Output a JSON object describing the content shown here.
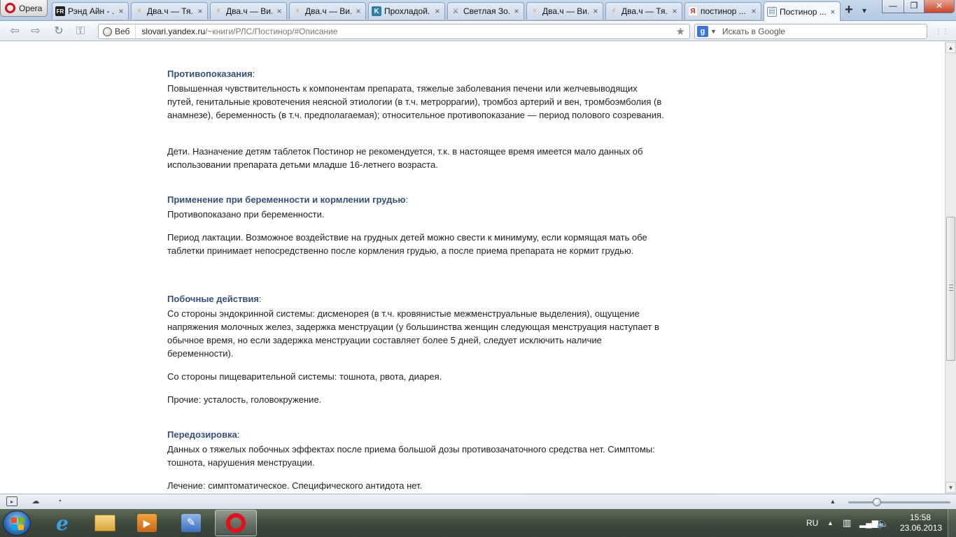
{
  "browser": {
    "menu_label": "Opera",
    "tabs": [
      {
        "title": "Рэнд Айн - ...",
        "icon": "fr-icon",
        "color": "#222222",
        "glyph": "FR"
      },
      {
        "title": "Два.ч — Тя...",
        "icon": "bolt-icon",
        "color": "#f08a24",
        "glyph": "⚡"
      },
      {
        "title": "Два.ч — Ви...",
        "icon": "bolt-icon",
        "color": "#f08a24",
        "glyph": "⚡"
      },
      {
        "title": "Два.ч — Ви...",
        "icon": "bolt-icon",
        "color": "#f08a24",
        "glyph": "⚡"
      },
      {
        "title": "Прохладой...",
        "icon": "k-icon",
        "color": "#2f7ea6",
        "glyph": "K"
      },
      {
        "title": "Светлая Зо...",
        "icon": "sword-icon",
        "color": "#555555",
        "glyph": "/"
      },
      {
        "title": "Два.ч — Ви...",
        "icon": "bolt-icon",
        "color": "#f08a24",
        "glyph": "⚡"
      },
      {
        "title": "Два.ч — Тя...",
        "icon": "bolt-icon",
        "color": "#f08a24",
        "glyph": "⚡"
      },
      {
        "title": "постинор ...",
        "icon": "yandex-icon",
        "color": "#e02020",
        "glyph": "Я"
      },
      {
        "title": "Постинор ...",
        "icon": "page-icon",
        "color": "#6a8bb5",
        "glyph": "▤"
      }
    ],
    "active_tab": 9,
    "address": {
      "badge": "Веб",
      "domain": "slovari.yandex.ru",
      "path": "/~книги/РЛС/Постинор/#Описание"
    },
    "search_placeholder": "Искать в Google"
  },
  "article": {
    "sections": [
      {
        "heading": "Противопоказания",
        "paragraphs": [
          "Повышенная чувствительность к компонентам препарата, тяжелые заболевания печени или желчевыводящих путей, генитальные кровотечения неясной этиологии (в т.ч. метроррагии), тромбоз артерий и вен, тромбоэмболия (в анамнезе), беременность (в т.ч. предполагаемая); относительное противопоказание — период полового созревания.",
          "Дети. Назначение детям таблеток Постинор не рекомендуется, т.к. в настоящее время имеется мало данных об использовании препарата детьми младше 16-летнего возраста."
        ]
      },
      {
        "heading": "Применение при беременности и кормлении грудью",
        "paragraphs": [
          "Противопоказано при беременности.",
          "Период лактации. Возможное воздействие на грудных детей можно свести к минимуму, если кормящая мать обе таблетки принимает непосредственно после кормления грудью, а после приема препарата не кормит грудью."
        ]
      },
      {
        "heading": "Побочные действия",
        "paragraphs": [
          "Со стороны эндокринной системы: дисменорея (в т.ч. кровянистые межменструальные выделения), ощущение напряжения молочных желез, задержка менструации (у большинства женщин следующая менструация наступает в обычное время, но если задержка менструации составляет более 5 дней, следует исключить наличие беременности).",
          "Со стороны пищеварительной системы: тошнота, рвота, диарея.",
          "Прочие: усталость, головокружение."
        ]
      },
      {
        "heading": "Передозировка",
        "paragraphs": [
          "Данных о тяжелых побочных эффектах после приема большой дозы противозачаточного средства нет. Симптомы: тошнота, нарушения менструации.",
          "Лечение: симптоматическое. Специфического антидота нет."
        ]
      }
    ]
  },
  "system": {
    "language": "RU",
    "time": "15:58",
    "date": "23.06.2013"
  }
}
